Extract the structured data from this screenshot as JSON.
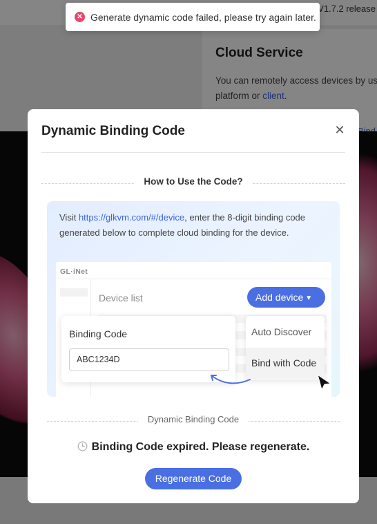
{
  "toast": {
    "message": "Generate dynamic code failed, please try again later.",
    "icon": "error-circle-icon",
    "color": "#e5486c"
  },
  "background": {
    "version": "V1.7.2 release",
    "cloud": {
      "title": "Cloud Service",
      "desc_line1": "You can remotely access devices by us",
      "desc_line2_prefix": "platform or ",
      "desc_link": "client",
      "desc_line2_suffix": ".",
      "bind_link": "Bind"
    }
  },
  "modal": {
    "title": "Dynamic Binding Code",
    "close_icon": "close-icon",
    "how_heading": "How to Use the Code?",
    "info": {
      "prefix": "Visit ",
      "link": "https://glkvm.com/#/device",
      "suffix": ", enter the 8-digit binding code generated below to complete cloud binding for the device."
    },
    "mock": {
      "logo": "GL·iNet",
      "device_list": "Device list",
      "add_device": "Add device",
      "binding_code_label": "Binding Code",
      "binding_code_value": "ABC1234D",
      "menu_auto": "Auto Discover",
      "menu_bind": "Bind with Code"
    },
    "code_heading": "Dynamic Binding Code",
    "status": "Binding Code expired. Please regenerate.",
    "regenerate": "Regenerate Code",
    "accent": "#4a6fe3"
  }
}
